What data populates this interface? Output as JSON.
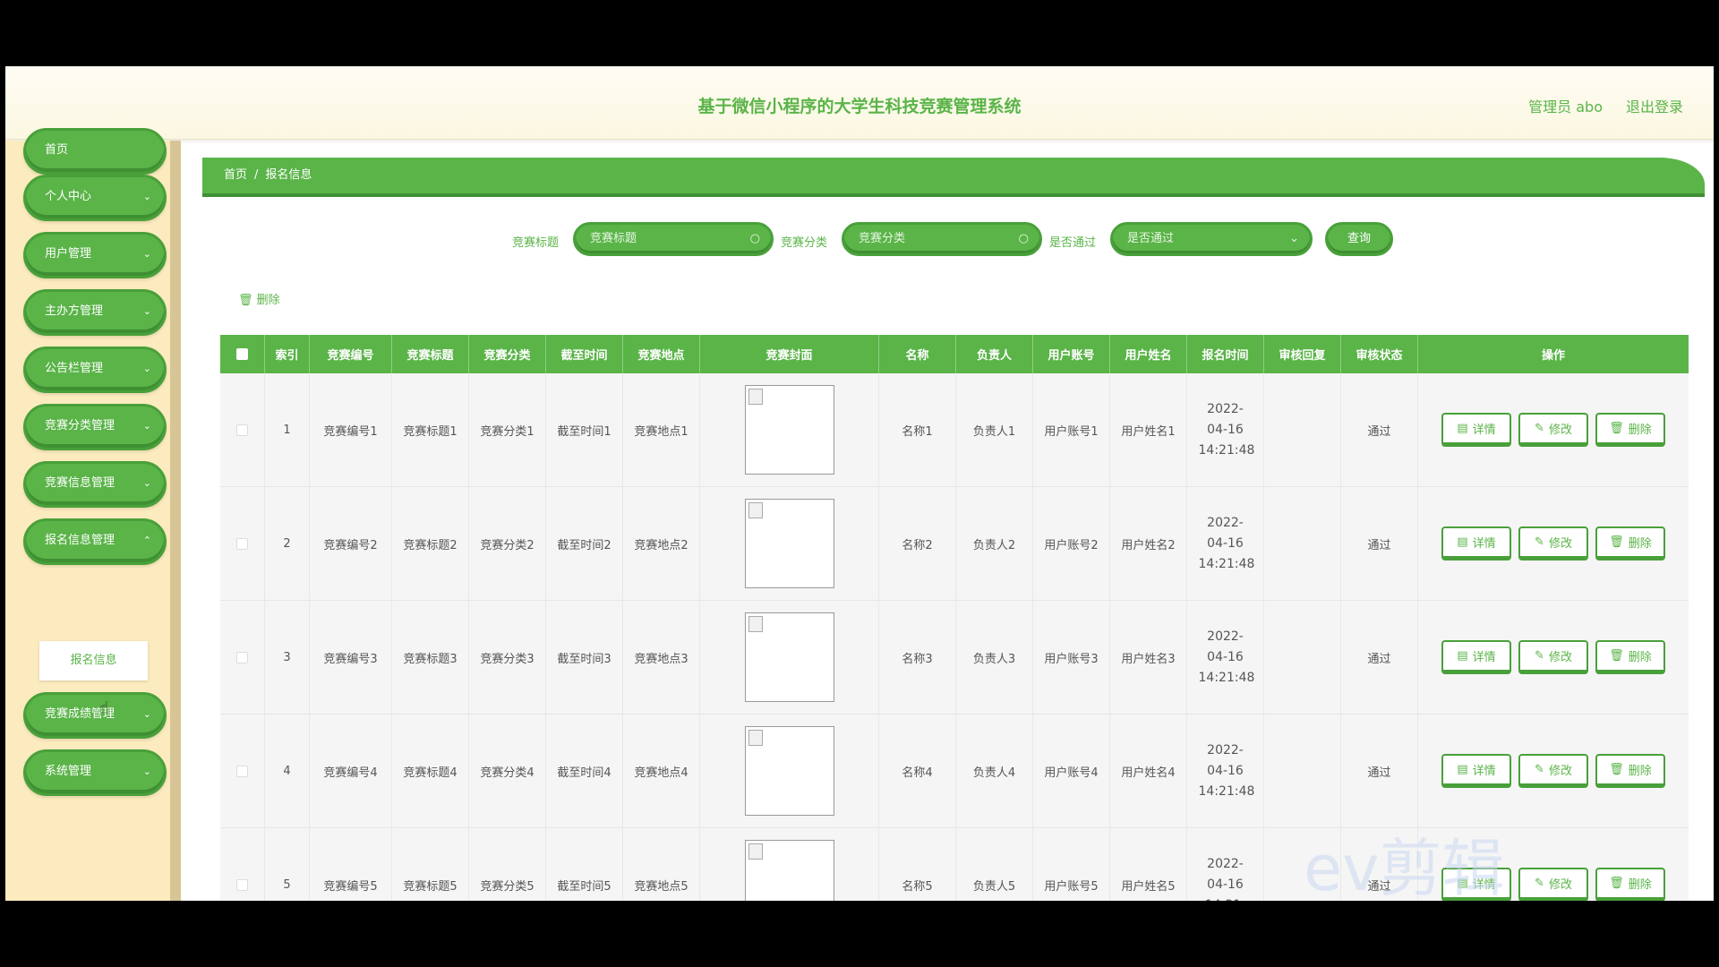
{
  "header": {
    "title": "基于微信小程序的大学生科技竞赛管理系统",
    "admin": "管理员 abo",
    "logout": "退出登录"
  },
  "sidebar": {
    "items": [
      {
        "label": "首页"
      },
      {
        "label": "个人中心"
      },
      {
        "label": "用户管理"
      },
      {
        "label": "主办方管理"
      },
      {
        "label": "公告栏管理"
      },
      {
        "label": "竞赛分类管理"
      },
      {
        "label": "竞赛信息管理"
      },
      {
        "label": "报名信息管理"
      },
      {
        "label": "竞赛成绩管理"
      },
      {
        "label": "系统管理"
      }
    ],
    "submenu_item": "报名信息"
  },
  "breadcrumb": {
    "home": "首页",
    "sep": "/",
    "current": "报名信息"
  },
  "search": {
    "title_label": "竞赛标题",
    "title_placeholder": "竞赛标题",
    "category_label": "竞赛分类",
    "category_placeholder": "竞赛分类",
    "passed_label": "是否通过",
    "passed_placeholder": "是否通过",
    "query_button": "查询"
  },
  "toolbar": {
    "delete_label": "删除"
  },
  "table": {
    "columns": [
      "索引",
      "竞赛编号",
      "竞赛标题",
      "竞赛分类",
      "截至时间",
      "竞赛地点",
      "竞赛封面",
      "名称",
      "负责人",
      "用户账号",
      "用户姓名",
      "报名时间",
      "审核回复",
      "审核状态",
      "操作"
    ],
    "rows": [
      {
        "index": "1",
        "code": "竞赛编号1",
        "title": "竞赛标题1",
        "category": "竞赛分类1",
        "deadline": "截至时间1",
        "place": "竞赛地点1",
        "name": "名称1",
        "leader": "负责人1",
        "account": "用户账号1",
        "username": "用户姓名1",
        "time": "2022-04-16 14:21:48",
        "reply": "",
        "status": "通过"
      },
      {
        "index": "2",
        "code": "竞赛编号2",
        "title": "竞赛标题2",
        "category": "竞赛分类2",
        "deadline": "截至时间2",
        "place": "竞赛地点2",
        "name": "名称2",
        "leader": "负责人2",
        "account": "用户账号2",
        "username": "用户姓名2",
        "time": "2022-04-16 14:21:48",
        "reply": "",
        "status": "通过"
      },
      {
        "index": "3",
        "code": "竞赛编号3",
        "title": "竞赛标题3",
        "category": "竞赛分类3",
        "deadline": "截至时间3",
        "place": "竞赛地点3",
        "name": "名称3",
        "leader": "负责人3",
        "account": "用户账号3",
        "username": "用户姓名3",
        "time": "2022-04-16 14:21:48",
        "reply": "",
        "status": "通过"
      },
      {
        "index": "4",
        "code": "竞赛编号4",
        "title": "竞赛标题4",
        "category": "竞赛分类4",
        "deadline": "截至时间4",
        "place": "竞赛地点4",
        "name": "名称4",
        "leader": "负责人4",
        "account": "用户账号4",
        "username": "用户姓名4",
        "time": "2022-04-16 14:21:48",
        "reply": "",
        "status": "通过"
      },
      {
        "index": "5",
        "code": "竞赛编号5",
        "title": "竞赛标题5",
        "category": "竞赛分类5",
        "deadline": "截至时间5",
        "place": "竞赛地点5",
        "name": "名称5",
        "leader": "负责人5",
        "account": "用户账号5",
        "username": "用户姓名5",
        "time": "2022-04-16 14:21:",
        "reply": "",
        "status": "通过"
      }
    ],
    "actions": {
      "detail": "详情",
      "edit": "修改",
      "delete": "删除"
    }
  },
  "watermark": "ev剪辑",
  "colors": {
    "primary": "#5ab448",
    "sidebar_bg": "#fcebbe",
    "header_bg": "#fffdf4"
  }
}
